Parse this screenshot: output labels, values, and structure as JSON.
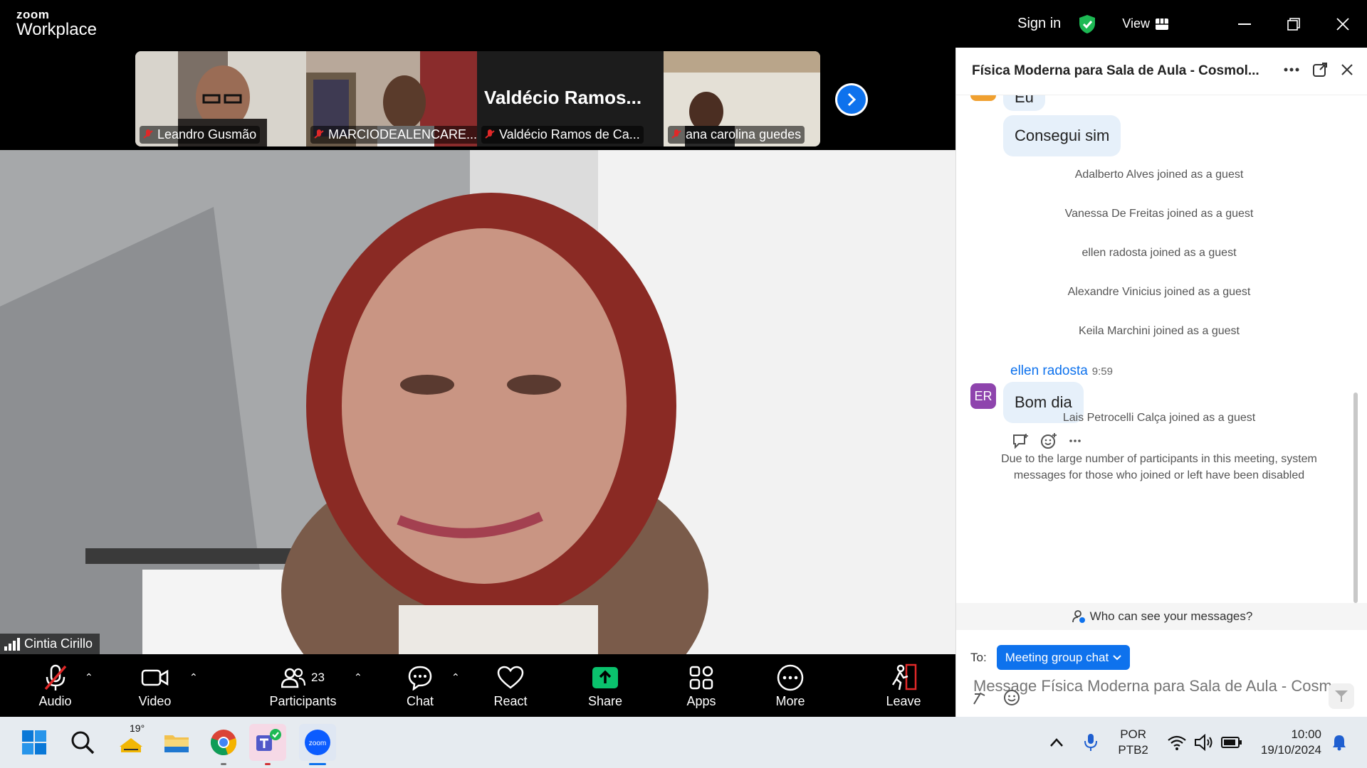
{
  "app": {
    "brand_small": "zoom",
    "brand_large": "Workplace"
  },
  "titlebar": {
    "sign_in": "Sign in",
    "view": "View"
  },
  "thumbnails": [
    {
      "name": "Leandro Gusmão",
      "muted": true
    },
    {
      "name": "MARCIODEALENCARE...",
      "muted": true
    },
    {
      "name": "Valdécio Ramos de Ca...",
      "big_name": "Valdécio  Ramos...",
      "muted": true
    },
    {
      "name": "ana carolina guedes",
      "muted": true
    }
  ],
  "main_video": {
    "speaker": "Cintia Cirillo"
  },
  "toolbar": {
    "audio": "Audio",
    "video": "Video",
    "participants": "Participants",
    "participant_count": "23",
    "chat": "Chat",
    "react": "React",
    "share": "Share",
    "apps": "Apps",
    "more": "More",
    "leave": "Leave"
  },
  "chat": {
    "title": "Física Moderna para Sala de Aula - Cosmol...",
    "partial_bubble": "Eu",
    "bubble_1": "Consegui sim",
    "system": [
      "Adalberto Alves joined as a guest",
      "Vanessa De Freitas joined as a guest",
      "ellen radosta joined as a guest",
      "Alexandre Vinicius joined as a guest",
      "Keila Marchini joined as a guest"
    ],
    "message": {
      "sender": "ellen radosta",
      "time": "9:59",
      "avatar": "ER",
      "text": "Bom dia"
    },
    "system_after": "Lais Petrocelli Calça joined as a guest",
    "notice": "Due to the large number of participants in this meeting, system messages for those who joined or left have been disabled",
    "who_can_see": "Who can see your messages?",
    "to_label": "To:",
    "to_value": "Meeting group chat",
    "input_placeholder": "Message Física Moderna para Sala de Aula - Cosm..."
  },
  "taskbar": {
    "weather_temp": "19°",
    "lang_1": "POR",
    "lang_2": "PTB2",
    "time": "10:00",
    "date": "19/10/2024"
  },
  "colors": {
    "accent": "#0e72ed",
    "share_green": "#0ac26d",
    "leave_red": "#e02828"
  }
}
